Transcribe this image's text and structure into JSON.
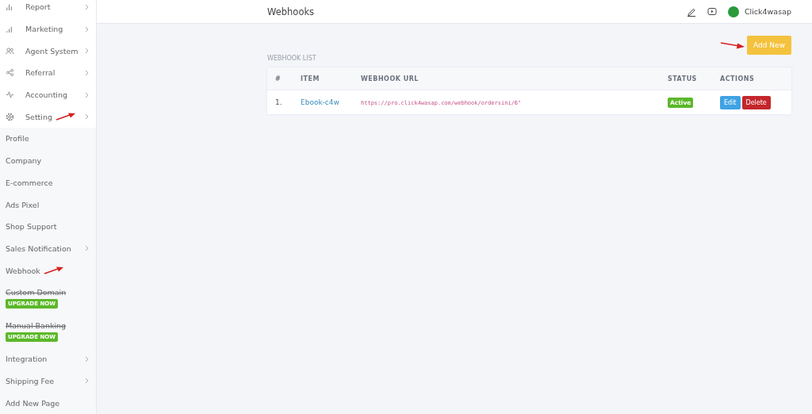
{
  "sidebar": {
    "items": [
      {
        "label": "Report",
        "chevron": true,
        "marked": false
      },
      {
        "label": "Marketing",
        "chevron": true,
        "marked": false
      },
      {
        "label": "Agent System",
        "chevron": true,
        "marked": false
      },
      {
        "label": "Referral",
        "chevron": true,
        "marked": false
      },
      {
        "label": "Accounting",
        "chevron": true,
        "marked": false
      },
      {
        "label": "Setting",
        "chevron": true,
        "marked": true,
        "expanded": true,
        "children": [
          {
            "label": "Profile",
            "chevron": false,
            "marked": false,
            "locked": false
          },
          {
            "label": "Company",
            "chevron": false,
            "marked": false,
            "locked": false
          },
          {
            "label": "E-commerce",
            "chevron": false,
            "marked": false,
            "locked": false
          },
          {
            "label": "Ads Pixel",
            "chevron": false,
            "marked": false,
            "locked": false
          },
          {
            "label": "Shop Support",
            "chevron": false,
            "marked": false,
            "locked": false
          },
          {
            "label": "Sales Notification",
            "chevron": true,
            "marked": false,
            "locked": false
          },
          {
            "label": "Webhook",
            "chevron": false,
            "marked": true,
            "locked": false
          },
          {
            "label": "Custom Domain",
            "chevron": false,
            "marked": false,
            "locked": true,
            "badge": "UPGRADE NOW"
          },
          {
            "label": "Manual Banking",
            "chevron": false,
            "marked": false,
            "locked": true,
            "badge": "UPGRADE NOW"
          },
          {
            "label": "Integration",
            "chevron": true,
            "marked": false,
            "locked": false
          },
          {
            "label": "Shipping Fee",
            "chevron": true,
            "marked": false,
            "locked": false
          },
          {
            "label": "Add New Page",
            "chevron": false,
            "marked": false,
            "locked": false
          }
        ]
      }
    ]
  },
  "header": {
    "title": "Webhooks",
    "user": "Click4wasap"
  },
  "section": {
    "title": "WEBHOOK LIST",
    "add_button": {
      "label": "Add New",
      "marked": true
    }
  },
  "table": {
    "columns": [
      "#",
      "ITEM",
      "WEBHOOK URL",
      "STATUS",
      "ACTIONS"
    ],
    "rows": [
      {
        "number": "1.",
        "item": "Ebook-c4w",
        "url": "https://pro.click4wasap.com/webhook/ordersini/6\"",
        "status": "Active",
        "actions": [
          "Edit",
          "Delete"
        ]
      }
    ]
  }
}
